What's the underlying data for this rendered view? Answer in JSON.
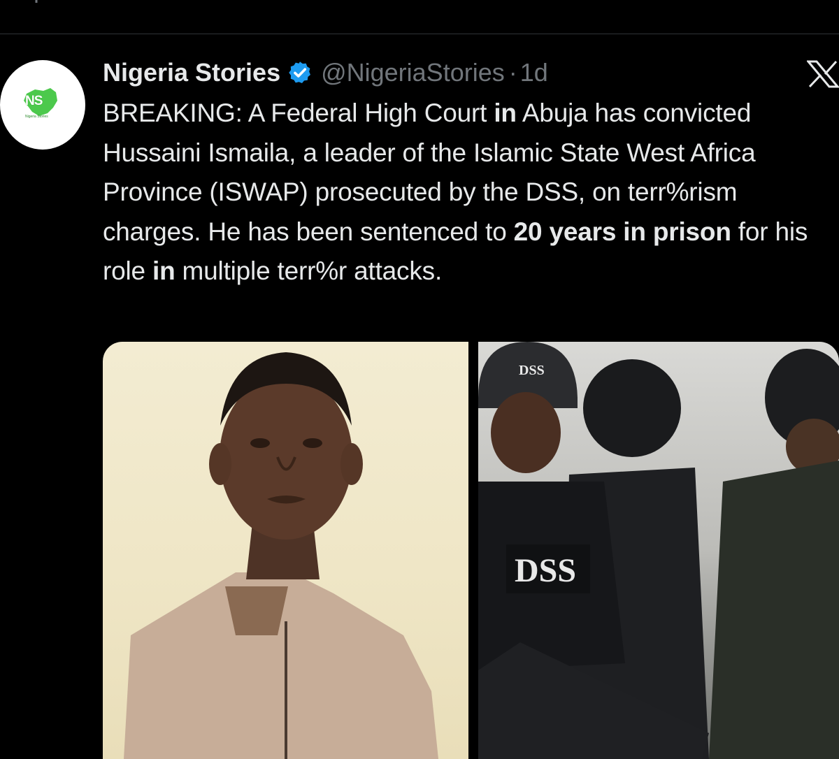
{
  "top_actions": {
    "icons": [
      "reply-icon",
      "retweet-icon",
      "views-icon",
      "bookmark-icon",
      "share-icon"
    ]
  },
  "tweet": {
    "author": {
      "display_name": "Nigeria Stories",
      "handle": "@NigeriaStories",
      "verified": true,
      "avatar_text": "NS",
      "avatar_subtext": "Nigeria Stories"
    },
    "separator": "·",
    "time": "1d",
    "text_segments": [
      {
        "text": "BREAKING: A Federal High Court ",
        "bold": false
      },
      {
        "text": "in",
        "bold": true
      },
      {
        "text": " Abuja has convicted Hussaini Ismaila, a leader of the Islamic State West Africa Province (ISWAP) prosecuted by the DSS, on terr%rism charges. He has been sentenced to ",
        "bold": false
      },
      {
        "text": "20 years in prison",
        "bold": true
      },
      {
        "text": " for his role ",
        "bold": false
      },
      {
        "text": "in",
        "bold": true
      },
      {
        "text": " multiple terr%r attacks.",
        "bold": false
      }
    ],
    "media": {
      "left_photo": "portrait-photo",
      "right_photo": "dss-officers-photo",
      "helmet_label": "DSS",
      "vest_label": "DSS"
    }
  },
  "colors": {
    "background": "#000000",
    "text_primary": "#e7e9ea",
    "text_secondary": "#71767b",
    "verified_blue": "#1d9bf0",
    "divider": "#2f3336"
  }
}
